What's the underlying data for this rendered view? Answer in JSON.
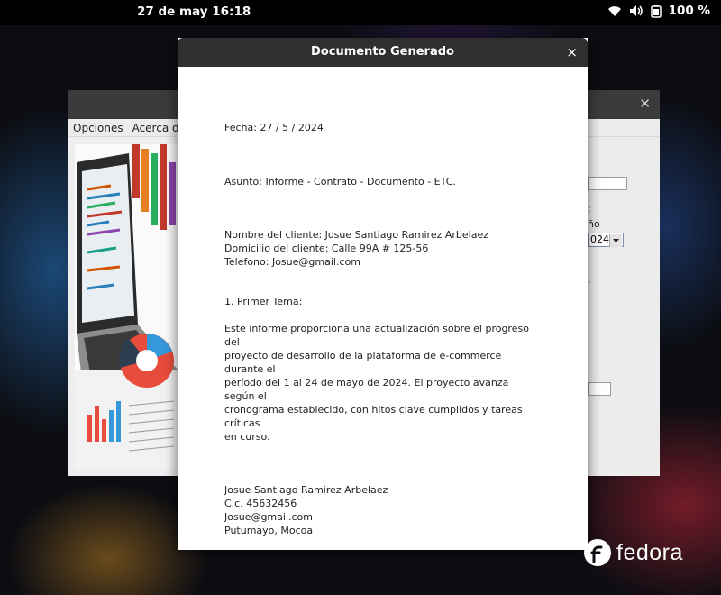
{
  "topbar": {
    "clock": "27 de may  16:18",
    "battery": "100 %",
    "icons": [
      "wifi-icon",
      "volume-icon",
      "battery-icon"
    ]
  },
  "background_window": {
    "menu": [
      "Opciones",
      "Acerca de"
    ],
    "right_labels": [
      ":",
      "ño",
      ":"
    ],
    "combo_value": "024"
  },
  "dialog": {
    "title": "Documento Generado",
    "close": "×",
    "date_line": "Fecha: 27 / 5 / 2024",
    "subject_line": "Asunto: Informe - Contrato - Documento - ETC.",
    "client_block": "Nombre del cliente: Josue Santiago Ramirez Arbelaez\nDomicilio del cliente: Calle 99A # 125-56\nTelefono: Josue@gmail.com",
    "section_title": "1. Primer Tema:",
    "body_text": "Este informe proporciona una actualización sobre el progreso del\nproyecto de desarrollo de la plataforma de e-commerce durante el\nperíodo del 1 al 24 de mayo de 2024. El proyecto avanza según el\ncronograma establecido, con hitos clave cumplidos y tareas críticas\nen curso.",
    "signature_block": "Josue Santiago Ramirez Arbelaez\nC.c. 45632456\nJosue@gmail.com\nPutumayo, Mocoa"
  },
  "brand": {
    "name": "fedora"
  }
}
